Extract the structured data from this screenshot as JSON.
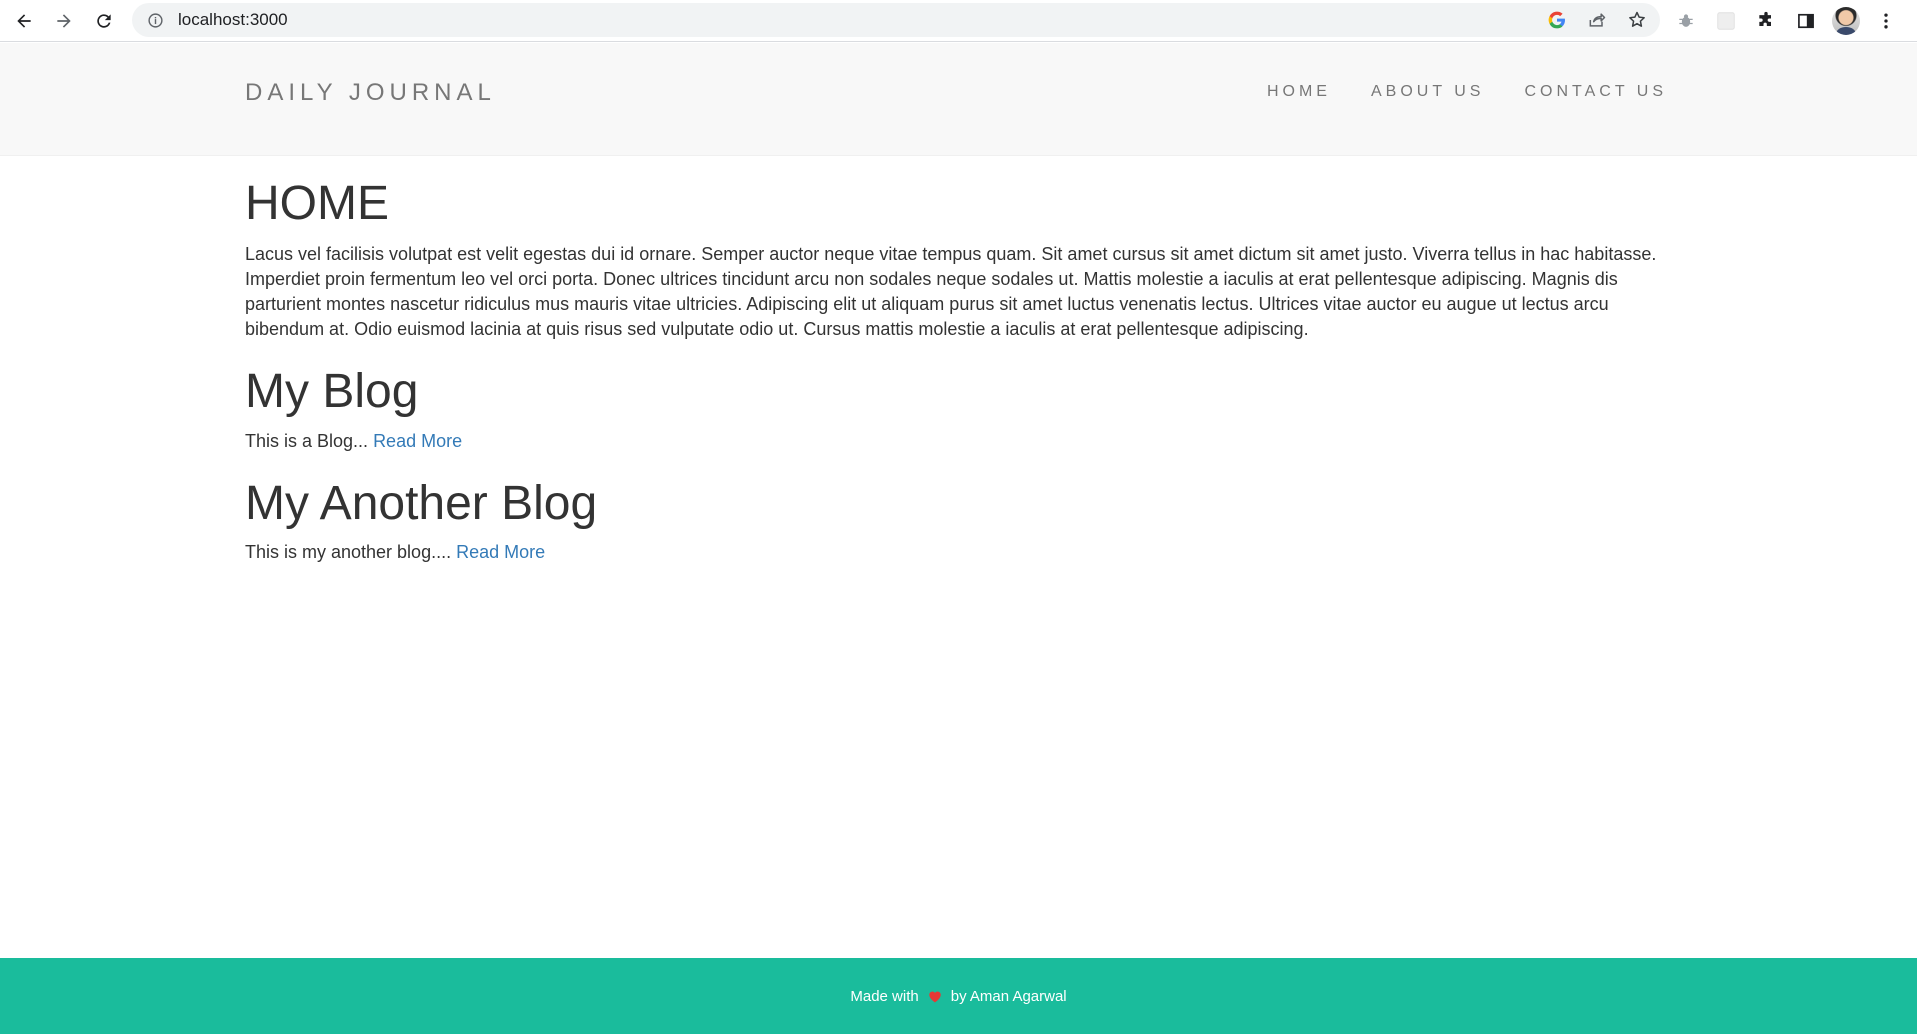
{
  "browser": {
    "url": "localhost:3000"
  },
  "header": {
    "brand": "DAILY JOURNAL",
    "nav": [
      {
        "label": "HOME"
      },
      {
        "label": "ABOUT US"
      },
      {
        "label": "CONTACT US"
      }
    ]
  },
  "main": {
    "title": "HOME",
    "intro": "Lacus vel facilisis volutpat est velit egestas dui id ornare. Semper auctor neque vitae tempus quam. Sit amet cursus sit amet dictum sit amet justo. Viverra tellus in hac habitasse. Imperdiet proin fermentum leo vel orci porta. Donec ultrices tincidunt arcu non sodales neque sodales ut. Mattis molestie a iaculis at erat pellentesque adipiscing. Magnis dis parturient montes nascetur ridiculus mus mauris vitae ultricies. Adipiscing elit ut aliquam purus sit amet luctus venenatis lectus. Ultrices vitae auctor eu augue ut lectus arcu bibendum at. Odio euismod lacinia at quis risus sed vulputate odio ut. Cursus mattis molestie a iaculis at erat pellentesque adipiscing.",
    "posts": [
      {
        "title": "My Blog",
        "excerpt": "This is a Blog... ",
        "read_more": "Read More"
      },
      {
        "title": "My Another Blog",
        "excerpt": "This is my another blog.... ",
        "read_more": "Read More"
      }
    ]
  },
  "footer": {
    "made_with": "Made with",
    "by": "by Aman Agarwal"
  },
  "colors": {
    "footer_bg": "#1abc9c",
    "link": "#337ab7",
    "header_bg": "#f8f8f8",
    "heart": "#e53935"
  },
  "icons": {
    "back": "arrow-left-icon",
    "forward": "arrow-right-icon",
    "reload": "reload-icon",
    "info": "info-icon",
    "google": "google-icon",
    "share": "share-icon",
    "bookmark": "star-icon",
    "extension_bug": "bug-icon",
    "extension_blank": "extension-placeholder-icon",
    "extensions": "puzzle-icon",
    "side_panel": "side-panel-icon",
    "menu": "kebab-menu-icon",
    "heart": "heart-icon"
  }
}
